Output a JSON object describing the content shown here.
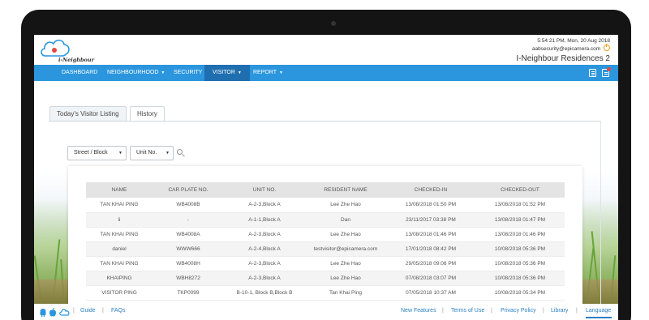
{
  "header": {
    "logo_text": "i-Neighbour",
    "datetime": "5:54:21 PM, Mon, 20 Aug 2018",
    "email": "aabsecurity@epicamera.com",
    "site_name": "I-Neighbour Residences 2"
  },
  "nav": {
    "items": [
      {
        "label": "DASHBOARD"
      },
      {
        "label": "NEIGHBOURHOOD"
      },
      {
        "label": "SECURITY"
      },
      {
        "label": "VISITOR"
      },
      {
        "label": "REPORT"
      }
    ]
  },
  "tabs": [
    {
      "label": "Today's Visitor Listing"
    },
    {
      "label": "History"
    }
  ],
  "filters": {
    "street": "Street / Block",
    "unit": "Unit No."
  },
  "table": {
    "headers": [
      "NAME",
      "CAR PLATE NO.",
      "UNIT NO.",
      "RESIDENT NAME",
      "CHECKED-IN",
      "CHECKED-OUT"
    ],
    "rows": [
      [
        "TAN KHAI PING",
        "WB4008B",
        "A-2-3,Block A",
        "Lee Zhe Hao",
        "13/08/2018 01:50 PM",
        "13/08/2018 01:52 PM"
      ],
      [
        "li",
        "-",
        "A-1-1,Block A",
        "Dan",
        "23/11/2017 03:38 PM",
        "13/08/2018 01:47 PM"
      ],
      [
        "TAN KHAI PING",
        "WB4008A",
        "A-2-3,Block A",
        "Lee Zhe Hao",
        "13/08/2018 01:46 PM",
        "13/08/2018 01:46 PM"
      ],
      [
        "daniel",
        "WWW666",
        "A-2-4,Block A",
        "testvisitor@epicamera.com",
        "17/01/2018 08:42 PM",
        "10/08/2018 05:36 PM"
      ],
      [
        "TAN KHAI PING",
        "WB4008H",
        "A-2-3,Block A",
        "Lee Zhe Hao",
        "29/05/2018 09:08 PM",
        "10/08/2018 05:36 PM"
      ],
      [
        "KHAIPING",
        "WBH8272",
        "A-2-3,Block A",
        "Lee Zhe Hao",
        "07/08/2018 03:07 PM",
        "10/08/2018 05:36 PM"
      ],
      [
        "VISITOR PING",
        "TKP0099",
        "B-10-1, Block B,Block B",
        "Tan Khai Ping",
        "07/05/2018 10:37 AM",
        "10/08/2018 05:34 PM"
      ]
    ]
  },
  "footer": {
    "guide": "Guide",
    "faqs": "FAQs",
    "new_features": "New Features",
    "terms": "Terms of Use",
    "privacy": "Privacy Policy",
    "library": "Library",
    "language": "Language"
  },
  "colors": {
    "nav_bg": "#2b96dd",
    "nav_active": "#1f6fb0",
    "link": "#2b7fc2",
    "power_icon": "#f19a1b"
  }
}
